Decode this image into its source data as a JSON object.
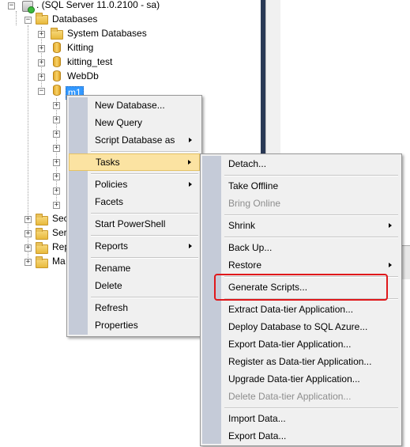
{
  "tree": {
    "server": ". (SQL Server 11.0.2100 - sa)",
    "databases": "Databases",
    "system_databases": "System Databases",
    "db1": "Kitting",
    "db2": "kitting_test",
    "db3": "WebDb",
    "db4": "m1",
    "sec": "Sec",
    "serv": "Serv",
    "rep": "Rep",
    "ma": "Ma"
  },
  "context_menu": {
    "items": [
      "New Database...",
      "New Query",
      "Script Database as",
      "Tasks",
      "Policies",
      "Facets",
      "Start PowerShell",
      "Reports",
      "Rename",
      "Delete",
      "Refresh",
      "Properties"
    ]
  },
  "tasks_menu": {
    "items": [
      "Detach...",
      "Take Offline",
      "Bring Online",
      "Shrink",
      "Back Up...",
      "Restore",
      "Generate Scripts...",
      "Extract Data-tier Application...",
      "Deploy Database to SQL Azure...",
      "Export Data-tier Application...",
      "Register as Data-tier Application...",
      "Upgrade Data-tier Application...",
      "Delete Data-tier Application...",
      "Import Data...",
      "Export Data..."
    ]
  }
}
